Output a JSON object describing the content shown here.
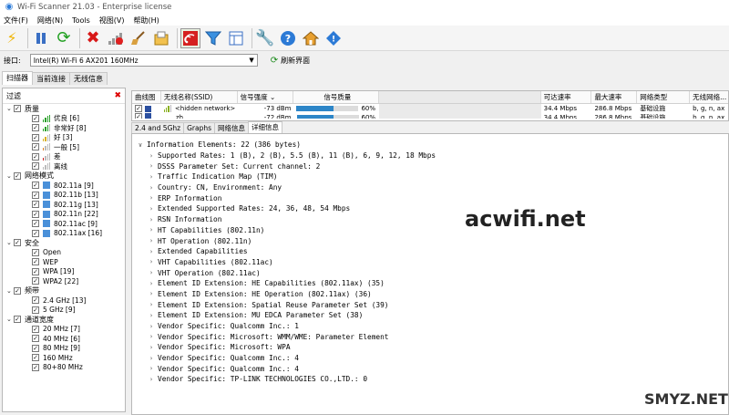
{
  "window": {
    "title": "Wi-Fi Scanner 21.03 - Enterprise license"
  },
  "menu": [
    "文件(F)",
    "网络(N)",
    "Tools",
    "视图(V)",
    "帮助(H)"
  ],
  "toolbar_icons": [
    "lightning-icon",
    "pause-icon",
    "refresh-icon",
    "delete-icon",
    "signal-red-icon",
    "broom-icon",
    "export-icon",
    "wifi-scan-icon",
    "filter-icon",
    "columns-icon",
    "wrench-icon",
    "help-icon",
    "home-icon",
    "info-icon"
  ],
  "adapter": {
    "label": "接口:",
    "value": "Intel(R) Wi-Fi 6 AX201 160MHz",
    "refresh_label": "刷新界面"
  },
  "main_tabs": [
    "扫描器",
    "当前连接",
    "无线信息"
  ],
  "filter": {
    "title": "过滤",
    "groups": [
      {
        "label": "质量",
        "items": [
          "优良 [6]",
          "非常好 [8]",
          "好 [3]",
          "一般 [5]",
          "差",
          "离线"
        ]
      },
      {
        "label": "网络模式",
        "items": [
          "802.11a [9]",
          "802.11b [13]",
          "802.11g [13]",
          "802.11n [22]",
          "802.11ac [9]",
          "802.11ax [16]"
        ]
      },
      {
        "label": "安全",
        "items": [
          "Open",
          "WEP",
          "WPA [19]",
          "WPA2 [22]"
        ]
      },
      {
        "label": "频带",
        "items": [
          "2.4 GHz [13]",
          "5 GHz [9]"
        ]
      },
      {
        "label": "通道宽度",
        "items": [
          "20 MHz [7]",
          "40 MHz [6]",
          "80 MHz [9]",
          "160 MHz",
          "80+80 MHz"
        ]
      }
    ]
  },
  "networks": {
    "columns": [
      "曲线图",
      "无线名称(SSID)",
      "信号强度",
      "信号质量",
      "",
      "",
      "",
      "",
      "可达速率",
      "最大速率",
      "网络类型",
      "无线网络..."
    ],
    "rows": [
      {
        "ssid": "<hidden network>",
        "signal": "-73 dBm",
        "quality": "60%",
        "quality_pct": 60,
        "rate": "34.4 Mbps",
        "max_rate": "286.8 Mbps",
        "type": "基础设施",
        "modes": "b, g, n, ax"
      },
      {
        "ssid": "zh...",
        "signal": "-72 dBm",
        "quality": "60%",
        "quality_pct": 60,
        "rate": "34.4 Mbps",
        "max_rate": "286.8 Mbps",
        "type": "基础设施",
        "modes": "b, g, n, ax"
      }
    ]
  },
  "detail_tabs": [
    "2.4 and 5Ghz",
    "Graphs",
    "网络信息",
    "详细信息"
  ],
  "details": {
    "root": "Information Elements: 22 (386 bytes)",
    "children": [
      "Supported Rates: 1 (B), 2 (B), 5.5 (B), 11 (B), 6, 9, 12, 18 Mbps",
      "DSSS Parameter Set: Current channel: 2",
      "Traffic Indication Map (TIM)",
      "Country: CN, Environment: Any",
      "ERP Information",
      "Extended Supported Rates: 24, 36, 48, 54 Mbps",
      "RSN Information",
      "HT Capabilities (802.11n)",
      "HT Operation (802.11n)",
      "Extended Capabilities",
      "VHT Capabilities (802.11ac)",
      "VHT Operation (802.11ac)",
      "Element ID Extension: HE Capabilities (802.11ax) (35)",
      "Element ID Extension: HE Operation (802.11ax) (36)",
      "Element ID Extension: Spatial Reuse Parameter Set (39)",
      "Element ID Extension: MU EDCA Parameter Set (38)",
      "Vendor Specific: Qualcomm Inc.: 1",
      "Vendor Specific: Microsoft: WMM/WME: Parameter Element",
      "Vendor Specific: Microsoft: WPA",
      "Vendor Specific: Qualcomm Inc.: 4",
      "Vendor Specific: Qualcomm Inc.: 4",
      "Vendor Specific: TP-LINK TECHNOLOGIES CO.,LTD.: 0"
    ]
  },
  "watermarks": [
    "acwifi.net",
    "SMYZ.NET"
  ],
  "colors": {
    "quality_bar": "#2d86c8",
    "signal_green": "#2aa02a",
    "close_red": "#dd0000"
  }
}
